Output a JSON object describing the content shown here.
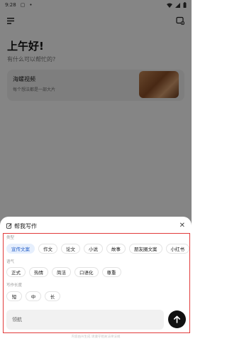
{
  "status_bar": {
    "time": "9:28"
  },
  "home": {
    "greeting": "上午好!",
    "subtitle": "有什么可以帮忙的?",
    "card": {
      "title": "海螺视频",
      "subtitle": "每个想法都是一部大片"
    }
  },
  "sheet": {
    "title": "帮我写作",
    "sections": {
      "type": {
        "label": "类型",
        "chips": [
          "宣传文案",
          "作文",
          "论文",
          "小说",
          "故事",
          "朋友圈文案",
          "小红书"
        ],
        "selected": "宣传文案"
      },
      "tone": {
        "label": "语气",
        "chips": [
          "正式",
          "热情",
          "简洁",
          "口语化",
          "尊重"
        ]
      },
      "length": {
        "label": "写作长度",
        "chips": [
          "短",
          "中",
          "长"
        ]
      }
    },
    "input": {
      "placeholder": "领航"
    },
    "footnote": "内容由AI生成 请遵守相关法律法规"
  },
  "colors": {
    "highlight_border": "#e23b3b",
    "chip_selected_bg": "#e6effd",
    "chip_selected_text": "#2a62c9"
  }
}
